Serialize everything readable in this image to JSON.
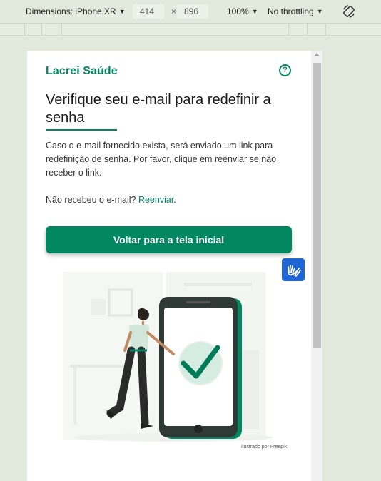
{
  "devtools": {
    "dimensions_label": "Dimensions: iPhone XR",
    "width": "414",
    "times": "×",
    "height": "896",
    "zoom": "100%",
    "throttling": "No throttling"
  },
  "page": {
    "logo": "Lacrei Saúde",
    "help_icon": "?",
    "title": "Verifique seu e-mail para redefinir a senha",
    "body": "Caso o e-mail fornecido exista, será enviado um link para redefinição de senha. Por favor, clique em reenviar se não receber o link.",
    "resend_prompt": "Não recebeu o e-mail?",
    "resend_link": "Reenviar",
    "resend_suffix": ".",
    "primary_button": "Voltar para a tela inicial",
    "credit": "Ilustrado por Freepik"
  },
  "colors": {
    "brand": "#018762",
    "accessibility": "#1e66d6"
  }
}
